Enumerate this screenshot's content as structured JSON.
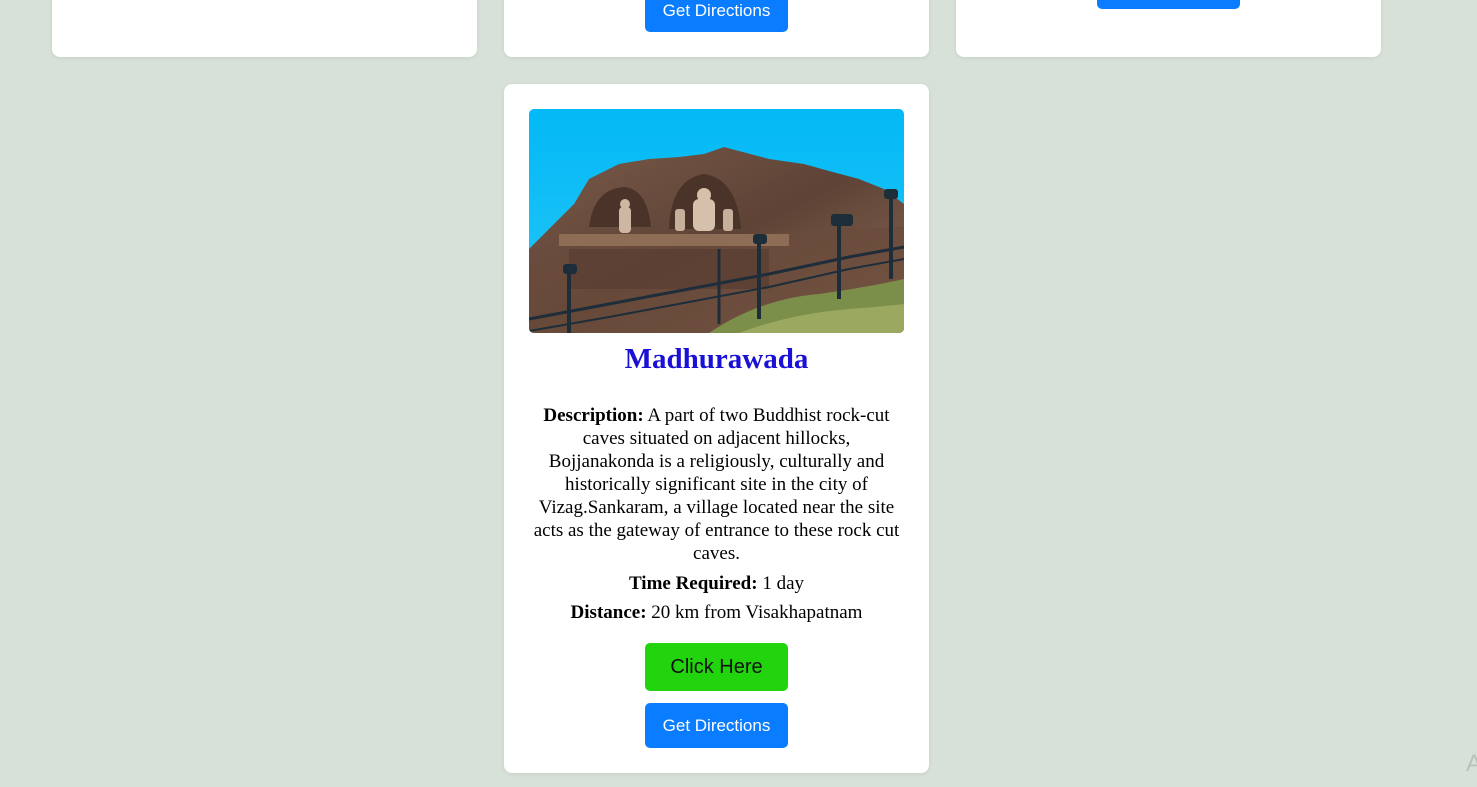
{
  "top_row": {
    "middle_card": {
      "directions_label": "Get Directions"
    },
    "right_card": {
      "button_label": ""
    }
  },
  "card": {
    "title": "Madhurawada",
    "description_label": "Description:",
    "description_text": " A part of two Buddhist rock-cut caves situated on adjacent hillocks, Bojjanakonda is a religiously, culturally and historically significant site in the city of Vizag.Sankaram, a village located near the site acts as the gateway of entrance to these rock cut caves.",
    "time_label": "Time Required:",
    "time_value": " 1 day",
    "distance_label": "Distance:",
    "distance_value": " 20 km from Visakhapatnam",
    "click_button_label": "Click Here",
    "directions_button_label": "Get Directions"
  },
  "corner_text": "A",
  "colors": {
    "page_background": "#d7e1d7",
    "title": "#1a10d6",
    "primary_button": "#0a7cff",
    "action_button": "#22d40d"
  }
}
